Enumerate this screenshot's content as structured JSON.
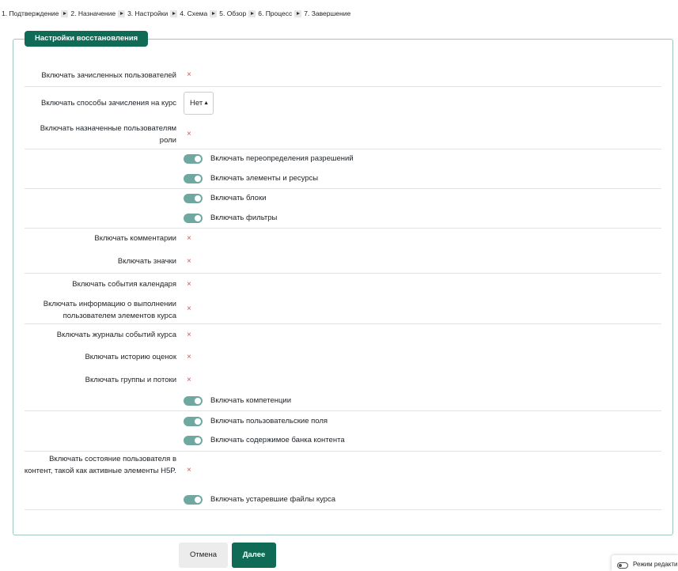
{
  "breadcrumb": [
    "1. Подтверждение",
    "2. Назначение",
    "3. Настройки",
    "4. Схема",
    "5. Обзор",
    "6. Процесс",
    "7. Завершение"
  ],
  "legend": "Настройки восстановления",
  "rows": {
    "enrolled_users": "Включать зачисленных пользователей",
    "enrol_methods": "Включать способы зачисления на курс",
    "enrol_methods_value": "Нет",
    "role_assignments": "Включать назначенные пользователям роли",
    "permission_overrides": "Включать переопределения разрешений",
    "activities": "Включать элементы и ресурсы",
    "blocks": "Включать блоки",
    "filters": "Включать фильтры",
    "comments": "Включать комментарии",
    "badges": "Включать значки",
    "calendar_events": "Включать события календаря",
    "completion_info": "Включать информацию о выполнении пользователем элементов курса",
    "logs": "Включать журналы событий курса",
    "grade_history": "Включать историю оценок",
    "groups": "Включать группы и потоки",
    "competencies": "Включать компетенции",
    "custom_fields": "Включать пользовательские поля",
    "content_bank": "Включать содержимое банка контента",
    "xapi_state": "Включать состояние пользователя в контент, такой как активные элементы H5P.",
    "legacy_files": "Включать устаревшие файлы курса"
  },
  "buttons": {
    "cancel": "Отмена",
    "next": "Далее"
  },
  "edit_mode_label": "Режим редактирования",
  "x_glyph": "×",
  "colors": {
    "primary": "#0f6b56",
    "toggle_on": "#6fa8a0",
    "cross": "#d9534f"
  }
}
